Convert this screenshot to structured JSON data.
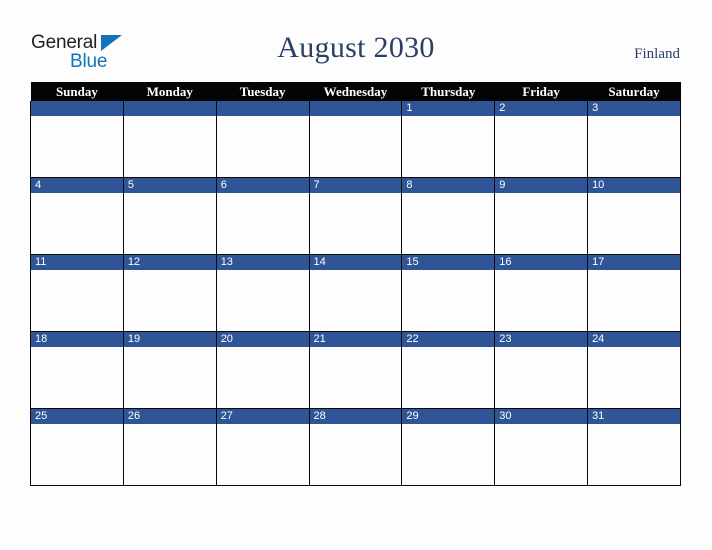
{
  "branding": {
    "logo_text_primary": "General",
    "logo_text_secondary": "Blue",
    "logo_primary_color": "#231f20",
    "logo_accent_color": "#1274bc"
  },
  "header": {
    "title": "August 2030",
    "month": "August",
    "year": "2030",
    "country": "Finland",
    "title_color": "#2b3e64"
  },
  "calendar": {
    "day_headers": [
      "Sunday",
      "Monday",
      "Tuesday",
      "Wednesday",
      "Thursday",
      "Friday",
      "Saturday"
    ],
    "header_background": "#040404",
    "header_text_color": "#ffffff",
    "date_band_color": "#2f5597",
    "date_text_color": "#ffffff",
    "cell_background": "#fdfdfd",
    "grid_line_color": "#0a0a0a",
    "weeks": [
      [
        {
          "date": ""
        },
        {
          "date": ""
        },
        {
          "date": ""
        },
        {
          "date": ""
        },
        {
          "date": "1"
        },
        {
          "date": "2"
        },
        {
          "date": "3"
        }
      ],
      [
        {
          "date": "4"
        },
        {
          "date": "5"
        },
        {
          "date": "6"
        },
        {
          "date": "7"
        },
        {
          "date": "8"
        },
        {
          "date": "9"
        },
        {
          "date": "10"
        }
      ],
      [
        {
          "date": "11"
        },
        {
          "date": "12"
        },
        {
          "date": "13"
        },
        {
          "date": "14"
        },
        {
          "date": "15"
        },
        {
          "date": "16"
        },
        {
          "date": "17"
        }
      ],
      [
        {
          "date": "18"
        },
        {
          "date": "19"
        },
        {
          "date": "20"
        },
        {
          "date": "21"
        },
        {
          "date": "22"
        },
        {
          "date": "23"
        },
        {
          "date": "24"
        }
      ],
      [
        {
          "date": "25"
        },
        {
          "date": "26"
        },
        {
          "date": "27"
        },
        {
          "date": "28"
        },
        {
          "date": "29"
        },
        {
          "date": "30"
        },
        {
          "date": "31"
        }
      ]
    ]
  },
  "page": {
    "background": "#fdfdfd"
  }
}
